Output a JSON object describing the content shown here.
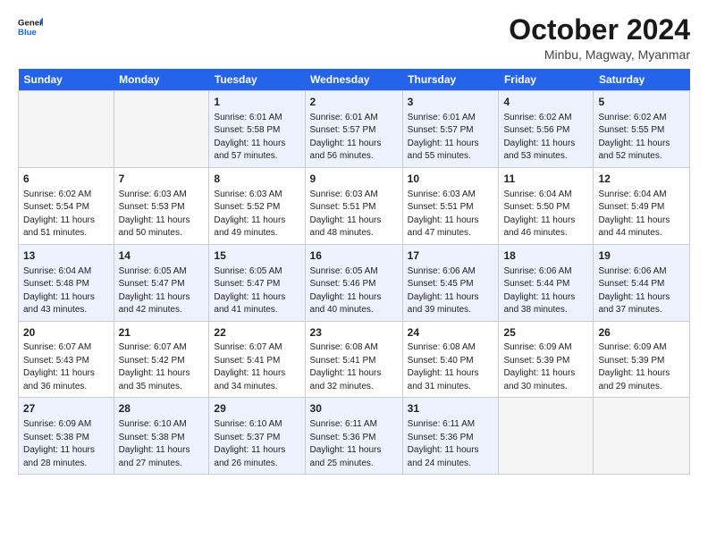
{
  "header": {
    "logo_line1": "General",
    "logo_line2": "Blue",
    "month_title": "October 2024",
    "subtitle": "Minbu, Magway, Myanmar"
  },
  "weekdays": [
    "Sunday",
    "Monday",
    "Tuesday",
    "Wednesday",
    "Thursday",
    "Friday",
    "Saturday"
  ],
  "weeks": [
    [
      {
        "day": "",
        "empty": true
      },
      {
        "day": "",
        "empty": true
      },
      {
        "day": "1",
        "sunrise": "Sunrise: 6:01 AM",
        "sunset": "Sunset: 5:58 PM",
        "daylight": "Daylight: 11 hours and 57 minutes."
      },
      {
        "day": "2",
        "sunrise": "Sunrise: 6:01 AM",
        "sunset": "Sunset: 5:57 PM",
        "daylight": "Daylight: 11 hours and 56 minutes."
      },
      {
        "day": "3",
        "sunrise": "Sunrise: 6:01 AM",
        "sunset": "Sunset: 5:57 PM",
        "daylight": "Daylight: 11 hours and 55 minutes."
      },
      {
        "day": "4",
        "sunrise": "Sunrise: 6:02 AM",
        "sunset": "Sunset: 5:56 PM",
        "daylight": "Daylight: 11 hours and 53 minutes."
      },
      {
        "day": "5",
        "sunrise": "Sunrise: 6:02 AM",
        "sunset": "Sunset: 5:55 PM",
        "daylight": "Daylight: 11 hours and 52 minutes."
      }
    ],
    [
      {
        "day": "6",
        "sunrise": "Sunrise: 6:02 AM",
        "sunset": "Sunset: 5:54 PM",
        "daylight": "Daylight: 11 hours and 51 minutes."
      },
      {
        "day": "7",
        "sunrise": "Sunrise: 6:03 AM",
        "sunset": "Sunset: 5:53 PM",
        "daylight": "Daylight: 11 hours and 50 minutes."
      },
      {
        "day": "8",
        "sunrise": "Sunrise: 6:03 AM",
        "sunset": "Sunset: 5:52 PM",
        "daylight": "Daylight: 11 hours and 49 minutes."
      },
      {
        "day": "9",
        "sunrise": "Sunrise: 6:03 AM",
        "sunset": "Sunset: 5:51 PM",
        "daylight": "Daylight: 11 hours and 48 minutes."
      },
      {
        "day": "10",
        "sunrise": "Sunrise: 6:03 AM",
        "sunset": "Sunset: 5:51 PM",
        "daylight": "Daylight: 11 hours and 47 minutes."
      },
      {
        "day": "11",
        "sunrise": "Sunrise: 6:04 AM",
        "sunset": "Sunset: 5:50 PM",
        "daylight": "Daylight: 11 hours and 46 minutes."
      },
      {
        "day": "12",
        "sunrise": "Sunrise: 6:04 AM",
        "sunset": "Sunset: 5:49 PM",
        "daylight": "Daylight: 11 hours and 44 minutes."
      }
    ],
    [
      {
        "day": "13",
        "sunrise": "Sunrise: 6:04 AM",
        "sunset": "Sunset: 5:48 PM",
        "daylight": "Daylight: 11 hours and 43 minutes."
      },
      {
        "day": "14",
        "sunrise": "Sunrise: 6:05 AM",
        "sunset": "Sunset: 5:47 PM",
        "daylight": "Daylight: 11 hours and 42 minutes."
      },
      {
        "day": "15",
        "sunrise": "Sunrise: 6:05 AM",
        "sunset": "Sunset: 5:47 PM",
        "daylight": "Daylight: 11 hours and 41 minutes."
      },
      {
        "day": "16",
        "sunrise": "Sunrise: 6:05 AM",
        "sunset": "Sunset: 5:46 PM",
        "daylight": "Daylight: 11 hours and 40 minutes."
      },
      {
        "day": "17",
        "sunrise": "Sunrise: 6:06 AM",
        "sunset": "Sunset: 5:45 PM",
        "daylight": "Daylight: 11 hours and 39 minutes."
      },
      {
        "day": "18",
        "sunrise": "Sunrise: 6:06 AM",
        "sunset": "Sunset: 5:44 PM",
        "daylight": "Daylight: 11 hours and 38 minutes."
      },
      {
        "day": "19",
        "sunrise": "Sunrise: 6:06 AM",
        "sunset": "Sunset: 5:44 PM",
        "daylight": "Daylight: 11 hours and 37 minutes."
      }
    ],
    [
      {
        "day": "20",
        "sunrise": "Sunrise: 6:07 AM",
        "sunset": "Sunset: 5:43 PM",
        "daylight": "Daylight: 11 hours and 36 minutes."
      },
      {
        "day": "21",
        "sunrise": "Sunrise: 6:07 AM",
        "sunset": "Sunset: 5:42 PM",
        "daylight": "Daylight: 11 hours and 35 minutes."
      },
      {
        "day": "22",
        "sunrise": "Sunrise: 6:07 AM",
        "sunset": "Sunset: 5:41 PM",
        "daylight": "Daylight: 11 hours and 34 minutes."
      },
      {
        "day": "23",
        "sunrise": "Sunrise: 6:08 AM",
        "sunset": "Sunset: 5:41 PM",
        "daylight": "Daylight: 11 hours and 32 minutes."
      },
      {
        "day": "24",
        "sunrise": "Sunrise: 6:08 AM",
        "sunset": "Sunset: 5:40 PM",
        "daylight": "Daylight: 11 hours and 31 minutes."
      },
      {
        "day": "25",
        "sunrise": "Sunrise: 6:09 AM",
        "sunset": "Sunset: 5:39 PM",
        "daylight": "Daylight: 11 hours and 30 minutes."
      },
      {
        "day": "26",
        "sunrise": "Sunrise: 6:09 AM",
        "sunset": "Sunset: 5:39 PM",
        "daylight": "Daylight: 11 hours and 29 minutes."
      }
    ],
    [
      {
        "day": "27",
        "sunrise": "Sunrise: 6:09 AM",
        "sunset": "Sunset: 5:38 PM",
        "daylight": "Daylight: 11 hours and 28 minutes."
      },
      {
        "day": "28",
        "sunrise": "Sunrise: 6:10 AM",
        "sunset": "Sunset: 5:38 PM",
        "daylight": "Daylight: 11 hours and 27 minutes."
      },
      {
        "day": "29",
        "sunrise": "Sunrise: 6:10 AM",
        "sunset": "Sunset: 5:37 PM",
        "daylight": "Daylight: 11 hours and 26 minutes."
      },
      {
        "day": "30",
        "sunrise": "Sunrise: 6:11 AM",
        "sunset": "Sunset: 5:36 PM",
        "daylight": "Daylight: 11 hours and 25 minutes."
      },
      {
        "day": "31",
        "sunrise": "Sunrise: 6:11 AM",
        "sunset": "Sunset: 5:36 PM",
        "daylight": "Daylight: 11 hours and 24 minutes."
      },
      {
        "day": "",
        "empty": true
      },
      {
        "day": "",
        "empty": true
      }
    ]
  ]
}
